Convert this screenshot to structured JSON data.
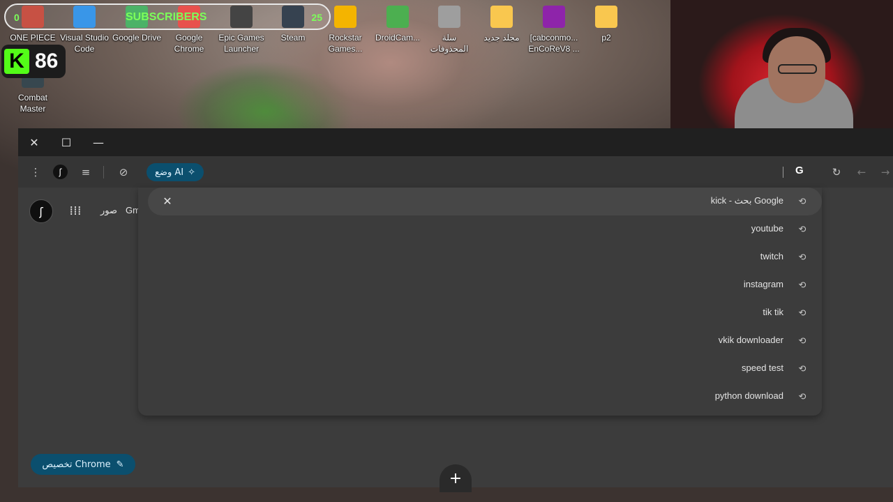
{
  "desktop": {
    "icons": [
      {
        "label": "ONE PIECE",
        "color": "#c0392b",
        "icon": "onepiece-icon"
      },
      {
        "label": "Visual Studio Code",
        "color": "#1e88e5",
        "icon": "vscode-icon"
      },
      {
        "label": "Google Drive",
        "color": "#34a853",
        "icon": "drive-icon"
      },
      {
        "label": "Google Chrome",
        "color": "#e53935",
        "icon": "chrome-icon"
      },
      {
        "label": "Epic Games Launcher",
        "color": "#2b2b2b",
        "icon": "epic-icon"
      },
      {
        "label": "Steam",
        "color": "#1b2838",
        "icon": "steam-icon"
      },
      {
        "label": "Rockstar Games...",
        "color": "#f4b400",
        "icon": "rockstar-icon"
      },
      {
        "label": "DroidCam...",
        "color": "#4caf50",
        "icon": "droidcam-icon"
      },
      {
        "label": "سلة المحذوفات",
        "color": "#9e9e9e",
        "icon": "recycle-bin-icon"
      },
      {
        "label": "مجلد جديد",
        "color": "#f9c74f",
        "icon": "folder-icon"
      },
      {
        "label": "[cabconmo... EnCoReV8 ...",
        "color": "#8e24aa",
        "icon": "winrar-icon"
      },
      {
        "label": "p2",
        "color": "#f9c74f",
        "icon": "folder-icon"
      },
      {
        "label": "Combat Master",
        "color": "#37474f",
        "icon": "combat-master-icon"
      }
    ]
  },
  "overlay": {
    "subs_left": "0",
    "subs_label": "SUBSCRIBERS",
    "subs_right": "25",
    "kick_letter": "K",
    "kick_count": "86"
  },
  "browser": {
    "window": {
      "close": "✕",
      "maximize": "☐",
      "minimize": "—"
    },
    "toolbar": {
      "ai_mode_label": "وضع AI",
      "google_letter": "G"
    },
    "page": {
      "links": [
        "صور",
        "Gm"
      ],
      "customize_label": "تخصيص Chrome",
      "add_shortcut": "+"
    },
    "search_clear": "✕",
    "suggestions": [
      {
        "text": "kick - بحث Google"
      },
      {
        "text": "youtube"
      },
      {
        "text": "twitch"
      },
      {
        "text": "instagram"
      },
      {
        "text": "tik tik"
      },
      {
        "text": "vkik downloader"
      },
      {
        "text": "speed test"
      },
      {
        "text": "python download"
      }
    ]
  }
}
